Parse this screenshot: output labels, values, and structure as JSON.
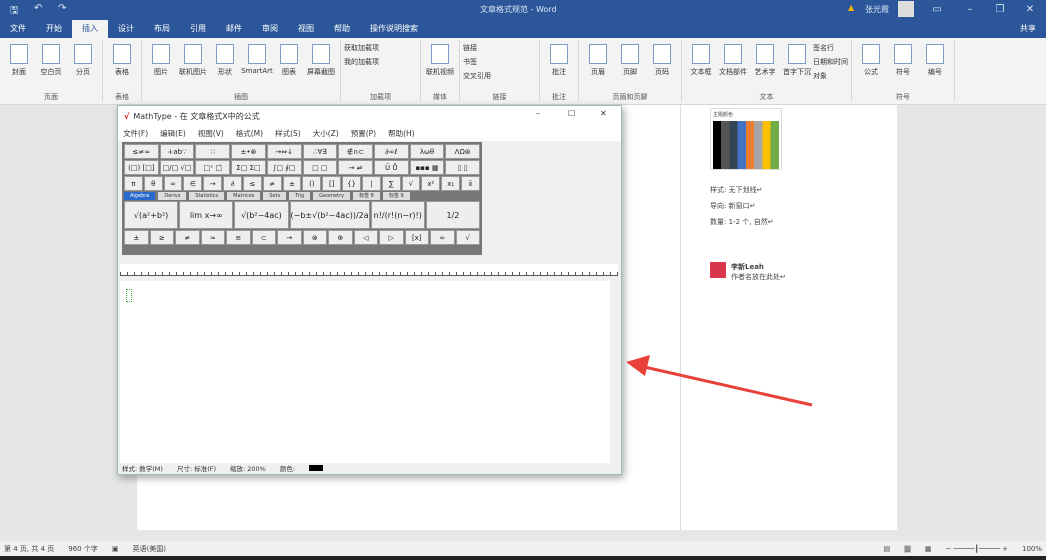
{
  "window": {
    "title": "文章格式规范 - Word",
    "user": "张光霞",
    "share": "共享"
  },
  "tabs": [
    "文件",
    "开始",
    "插入",
    "设计",
    "布局",
    "引用",
    "邮件",
    "审阅",
    "视图",
    "帮助"
  ],
  "tell_me": "操作说明搜索",
  "ribbon": {
    "groups": [
      {
        "label": "页面",
        "buttons": [
          "封面",
          "空白页",
          "分页"
        ]
      },
      {
        "label": "表格",
        "buttons": [
          "表格"
        ]
      },
      {
        "label": "插图",
        "buttons": [
          "图片",
          "联机图片",
          "形状",
          "SmartArt",
          "图表",
          "屏幕截图"
        ]
      },
      {
        "label": "加载项",
        "small": [
          "获取加载项",
          "我的加载项"
        ]
      },
      {
        "label": "媒体",
        "buttons": [
          "联机视频"
        ]
      },
      {
        "label": "链接",
        "small": [
          "链接",
          "书签",
          "交叉引用"
        ]
      },
      {
        "label": "批注",
        "buttons": [
          "批注"
        ]
      },
      {
        "label": "页眉和页脚",
        "buttons": [
          "页眉",
          "页脚",
          "页码"
        ]
      },
      {
        "label": "文本",
        "buttons": [
          "文本框",
          "文档部件",
          "艺术字",
          "首字下沉"
        ],
        "small": [
          "签名行",
          "日期和时间",
          "对象"
        ]
      },
      {
        "label": "符号",
        "buttons": [
          "公式",
          "符号",
          "编号"
        ]
      }
    ]
  },
  "mathtype": {
    "title": "MathType - 在 文章格式X中的公式",
    "menu": [
      "文件(F)",
      "编辑(E)",
      "视图(V)",
      "格式(M)",
      "样式(S)",
      "大小(Z)",
      "预置(P)",
      "帮助(H)"
    ],
    "row1": [
      "≤≠≈",
      "∔ab∵",
      "∷",
      "±•⊗",
      "→⇔↓",
      "∴∀∃",
      "∉∩⊂",
      "∂∞ℓ",
      "λωθ",
      "ΛΩ⊛"
    ],
    "row2": [
      "(□) [□]",
      "□/□ √□",
      "□ˣ □̇",
      "Σ□ Σ□",
      "∫□ ∮□",
      "□ □",
      "→ ⇌",
      "Ū Ů",
      "▪▪▪ ▦",
      "▯ ▯"
    ],
    "row3": [
      "π",
      "θ",
      "∞",
      "∈",
      "→",
      "∂",
      "≤",
      "≠",
      "±",
      "()",
      "[]",
      "{}",
      "∣",
      "∑",
      "√",
      "x²",
      "x₁",
      "x̄"
    ],
    "tabs": [
      "Algebra",
      "Derivs",
      "Statistics",
      "Matrices",
      "Sets",
      "Trig",
      "Geometry",
      "标签 8",
      "标签 9"
    ],
    "templates": [
      "√(a²+b²)",
      "lim x→∞",
      "√(b²−4ac)",
      "(−b±√(b²−4ac))/2a",
      "n!/(r!(n−r)!)",
      "1/2"
    ],
    "row5": [
      "±",
      "≥",
      "≠",
      "≈",
      "≡",
      "⊂",
      "→",
      "⊗",
      "⊕",
      "◁",
      "▷",
      "[x]",
      "∞",
      "√"
    ],
    "status": {
      "style": "样式: 数学(M)",
      "size": "尺寸: 标准(F)",
      "zoom": "缩放: 200%",
      "color": "颜色:"
    }
  },
  "comments": {
    "palette_label": "主题颜色",
    "items": [
      "样式: 无下划线↵",
      "导向: 新窗口↵",
      "数量: 1-2 个, 自然↵"
    ],
    "author": "李新Leah",
    "text": "作者名放在此处↵"
  },
  "statusbar": {
    "page": "第 4 页, 共 4 页",
    "words": "960 个字",
    "lang": "英语(美国)",
    "zoom": "100%"
  }
}
